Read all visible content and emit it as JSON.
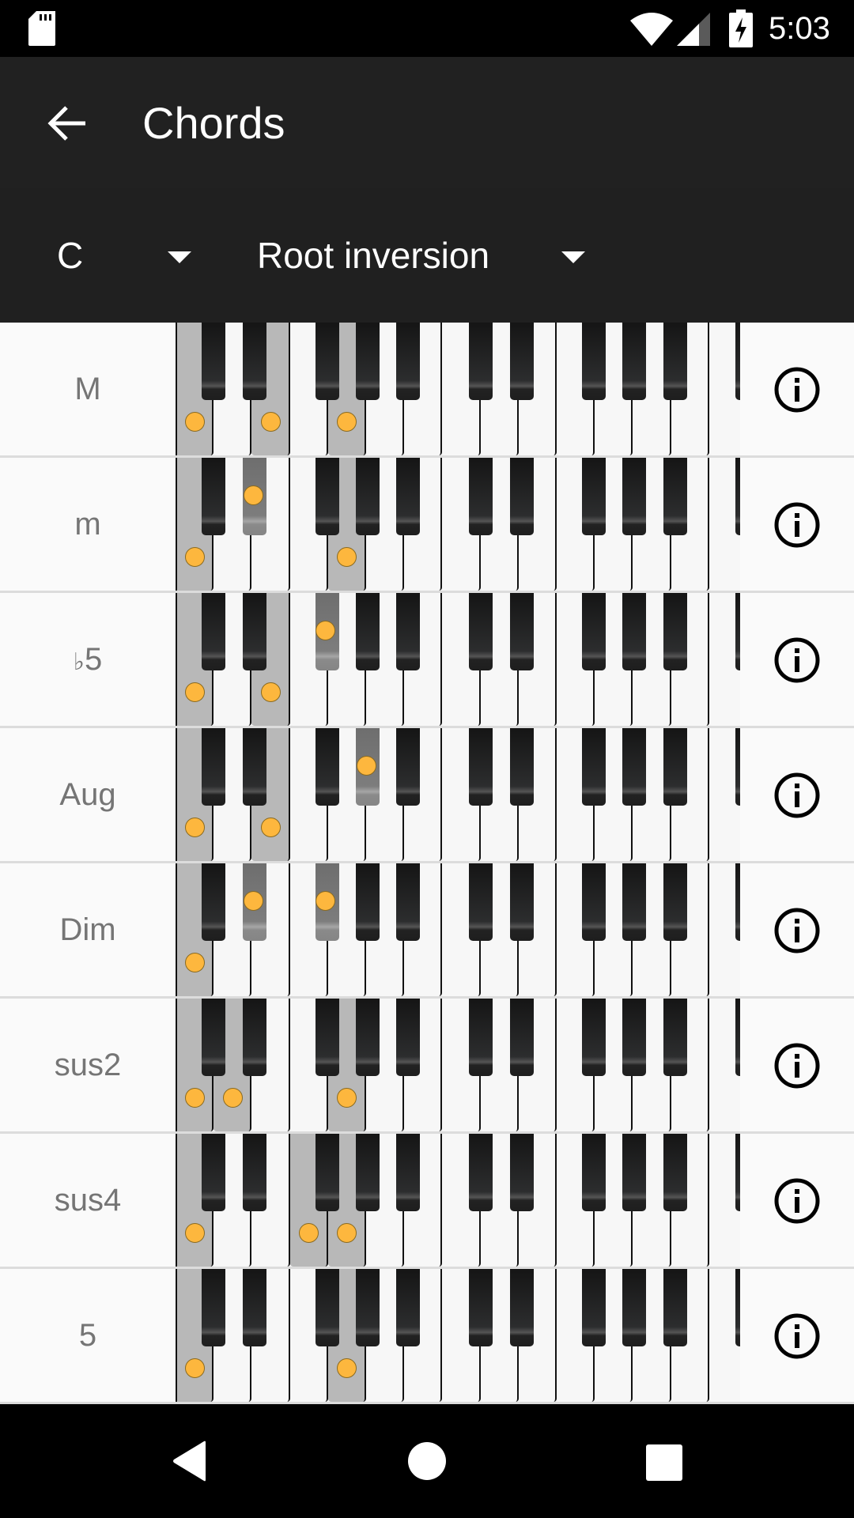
{
  "status_bar": {
    "time": "5:03",
    "icons": [
      "sd-card-icon",
      "wifi-icon",
      "cell-signal-icon",
      "battery-charging-icon"
    ]
  },
  "app_bar": {
    "back_icon": "arrow-left-icon",
    "title": "Chords"
  },
  "selectors": {
    "root_note": "C",
    "inversion": "Root inversion"
  },
  "keyboard": {
    "white_notes": [
      "C",
      "D",
      "E",
      "F",
      "G",
      "A",
      "B",
      "C",
      "D",
      "E",
      "F",
      "G",
      "A",
      "B",
      "C"
    ],
    "highlight_color": "#b8b8b8",
    "dot_color": "#fdb73e"
  },
  "chords": [
    {
      "label": "M",
      "flat": "",
      "notes": [
        "C",
        "E",
        "G"
      ]
    },
    {
      "label": "m",
      "flat": "",
      "notes": [
        "C",
        "D#",
        "G"
      ]
    },
    {
      "label": "5",
      "flat": "♭",
      "notes": [
        "C",
        "E",
        "F#"
      ]
    },
    {
      "label": "Aug",
      "flat": "",
      "notes": [
        "C",
        "E",
        "G#"
      ]
    },
    {
      "label": "Dim",
      "flat": "",
      "notes": [
        "C",
        "D#",
        "F#"
      ]
    },
    {
      "label": "sus2",
      "flat": "",
      "notes": [
        "C",
        "D",
        "G"
      ]
    },
    {
      "label": "sus4",
      "flat": "",
      "notes": [
        "C",
        "F",
        "G"
      ]
    },
    {
      "label": "5",
      "flat": "",
      "notes": [
        "C",
        "G"
      ]
    }
  ],
  "info_icon": "info-circle-icon",
  "nav_bar": {
    "icons": [
      "nav-back-icon",
      "nav-home-icon",
      "nav-recents-icon"
    ]
  }
}
